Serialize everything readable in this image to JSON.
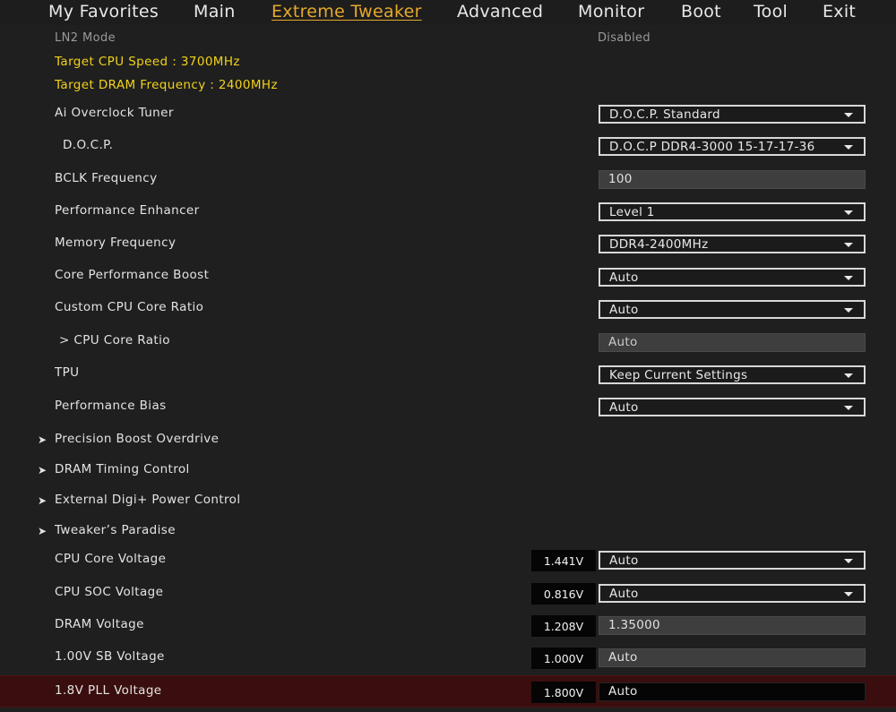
{
  "menu": [
    {
      "label": "My Favorites",
      "active": false
    },
    {
      "label": "Main",
      "active": false
    },
    {
      "label": "Extreme Tweaker",
      "active": true
    },
    {
      "label": "Advanced",
      "active": false
    },
    {
      "label": "Monitor",
      "active": false
    },
    {
      "label": "Boot",
      "active": false
    },
    {
      "label": "Tool",
      "active": false
    },
    {
      "label": "Exit",
      "active": false
    }
  ],
  "ln2": {
    "label": "LN2 Mode",
    "value": "Disabled"
  },
  "targets": {
    "cpu_speed": "Target CPU Speed : 3700MHz",
    "dram_freq": "Target DRAM Frequency : 2400MHz"
  },
  "settings": [
    {
      "label": "Ai Overclock Tuner",
      "value": "D.O.C.P. Standard"
    },
    {
      "label": "D.O.C.P.",
      "value": "D.O.C.P DDR4-3000 15-17-17-36"
    },
    {
      "label": "BCLK Frequency",
      "value": "100"
    },
    {
      "label": "Performance Enhancer",
      "value": "Level 1"
    },
    {
      "label": "Memory Frequency",
      "value": "DDR4-2400MHz"
    },
    {
      "label": "Core Performance Boost",
      "value": "Auto"
    },
    {
      "label": "Custom CPU Core Ratio",
      "value": "Auto"
    },
    {
      "label": "> CPU Core Ratio",
      "value": "Auto"
    },
    {
      "label": "TPU",
      "value": "Keep Current Settings"
    },
    {
      "label": "Performance Bias",
      "value": "Auto"
    }
  ],
  "submenus": [
    {
      "arrow": "➤",
      "label": "Precision Boost Overdrive"
    },
    {
      "arrow": "➤",
      "label": "DRAM Timing Control"
    },
    {
      "arrow": "➤",
      "label": "External Digi+ Power Control"
    },
    {
      "arrow": "➤",
      "label": "Tweaker’s Paradise"
    }
  ],
  "voltages": [
    {
      "label": "CPU Core Voltage",
      "reading": "1.441V",
      "value": "Auto"
    },
    {
      "label": "CPU SOC Voltage",
      "reading": "0.816V",
      "value": "Auto"
    },
    {
      "label": "DRAM Voltage",
      "reading": "1.208V",
      "value": "1.35000"
    },
    {
      "label": "1.00V SB Voltage",
      "reading": "1.000V",
      "value": "Auto"
    },
    {
      "label": "1.8V PLL Voltage",
      "reading": "1.800V",
      "value": "Auto"
    }
  ],
  "colors": {
    "accent": "#e6a92b",
    "yellow": "#f2d21a",
    "selected_row": "#3a0e0e"
  }
}
